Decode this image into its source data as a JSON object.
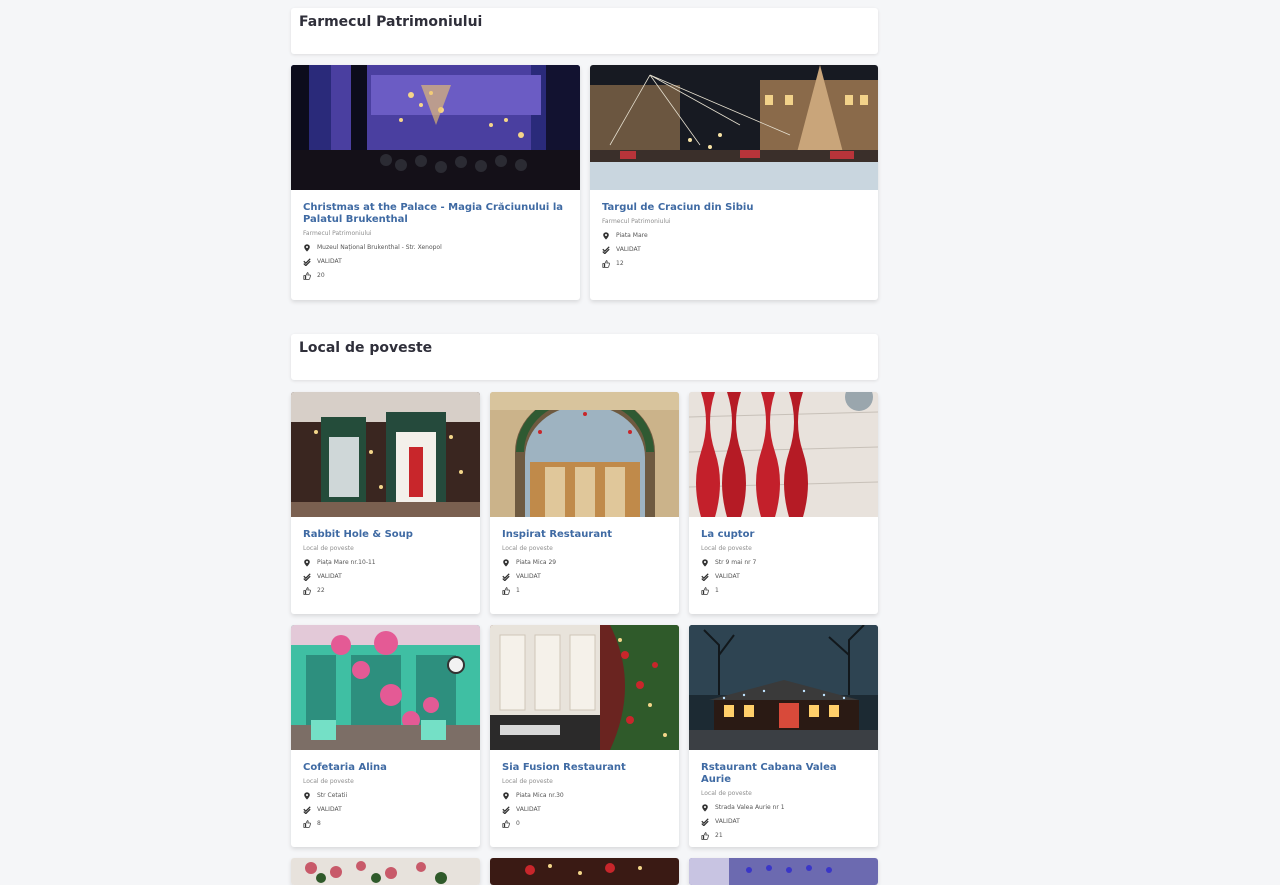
{
  "sections": [
    {
      "title": "Farmecul Patrimoniului",
      "cards": [
        {
          "title": "Christmas at the Palace - Magia Crăciunului la Palatul Brukenthal",
          "category": "Farmecul Patrimoniului",
          "address": "Muzeul Național Brukenthal - Str. Xenopol",
          "status": "VALIDAT",
          "likes": "20"
        },
        {
          "title": "Targul de Craciun din Sibiu",
          "category": "Farmecul Patrimoniului",
          "address": "Piata Mare",
          "status": "VALIDAT",
          "likes": "12"
        }
      ]
    },
    {
      "title": "Local de poveste",
      "cards": [
        {
          "title": "Rabbit Hole & Soup",
          "category": "Local de poveste",
          "address": "Piața Mare nr.10-11",
          "status": "VALIDAT",
          "likes": "22"
        },
        {
          "title": "Inspirat Restaurant",
          "category": "Local de poveste",
          "address": "Piata Mica 29",
          "status": "VALIDAT",
          "likes": "1"
        },
        {
          "title": "La cuptor",
          "category": "Local de poveste",
          "address": "Str 9 mai nr 7",
          "status": "VALIDAT",
          "likes": "1"
        },
        {
          "title": "Cofetaria Alina",
          "category": "Local de poveste",
          "address": "Str Cetatii",
          "status": "VALIDAT",
          "likes": "8"
        },
        {
          "title": "Sia Fusion Restaurant",
          "category": "Local de poveste",
          "address": "Piata Mica nr.30",
          "status": "VALIDAT",
          "likes": "0"
        },
        {
          "title": "Rstaurant Cabana Valea Aurie",
          "category": "Local de poveste",
          "address": "Strada Valea Aurie nr 1",
          "status": "VALIDAT",
          "likes": "21"
        }
      ]
    }
  ],
  "icons": {
    "location": "map-pin-icon",
    "status": "double-check-icon",
    "likes": "thumbs-up-icon"
  },
  "colors": {
    "page_bg": "#f5f6f8",
    "card_title": "#3f6aa3",
    "section_title": "#2f2f3a"
  }
}
